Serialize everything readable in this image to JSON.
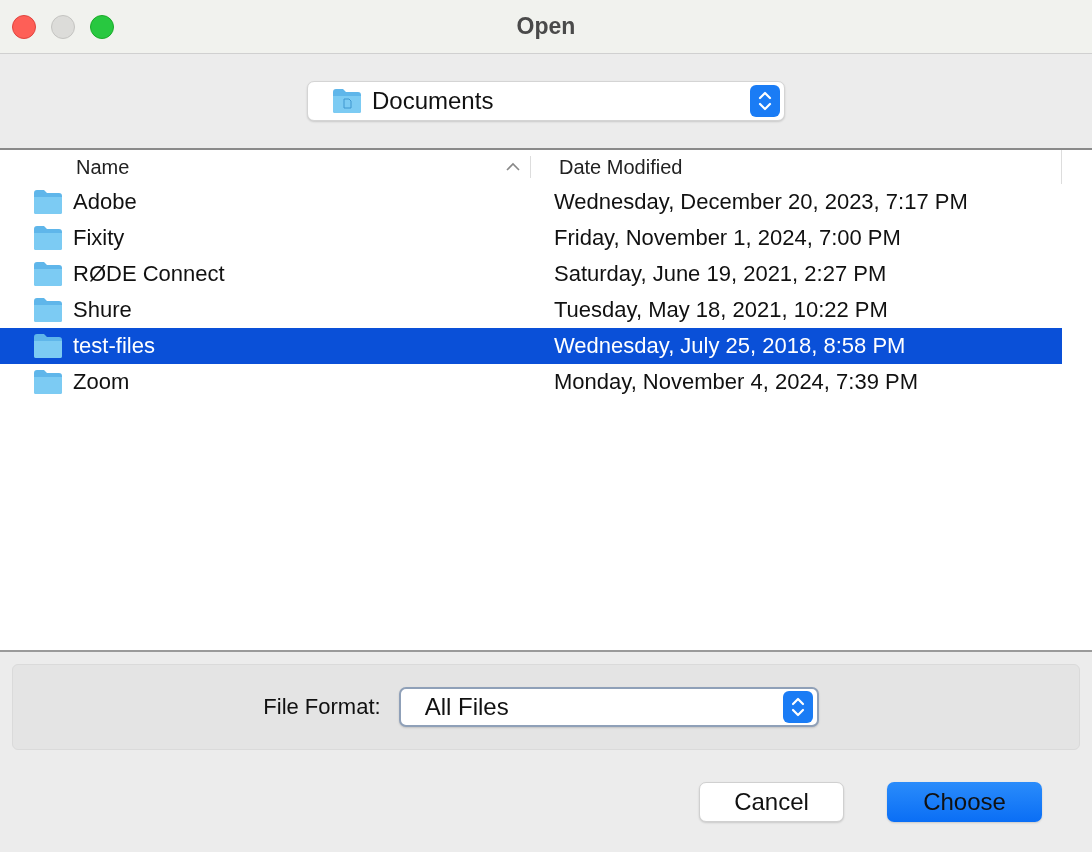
{
  "window": {
    "title": "Open"
  },
  "location": {
    "value": "Documents"
  },
  "table": {
    "columns": [
      {
        "label": "Name",
        "sorted": true
      },
      {
        "label": "Date Modified",
        "sorted": false
      }
    ],
    "rows": [
      {
        "name": "Adobe",
        "date": "Wednesday, December 20, 2023, 7:17 PM",
        "selected": false
      },
      {
        "name": "Fixity",
        "date": "Friday, November 1, 2024, 7:00 PM",
        "selected": false
      },
      {
        "name": "RØDE Connect",
        "date": "Saturday, June 19, 2021, 2:27 PM",
        "selected": false
      },
      {
        "name": "Shure",
        "date": "Tuesday, May 18, 2021, 10:22 PM",
        "selected": false
      },
      {
        "name": "test-files",
        "date": "Wednesday, July 25, 2018, 8:58 PM",
        "selected": true
      },
      {
        "name": "Zoom",
        "date": "Monday, November 4, 2024, 7:39 PM",
        "selected": false
      }
    ]
  },
  "format": {
    "label": "File Format:",
    "value": "All Files"
  },
  "buttons": [
    {
      "label": "Cancel",
      "kind": "secondary"
    },
    {
      "label": "Choose",
      "kind": "primary"
    }
  ]
}
